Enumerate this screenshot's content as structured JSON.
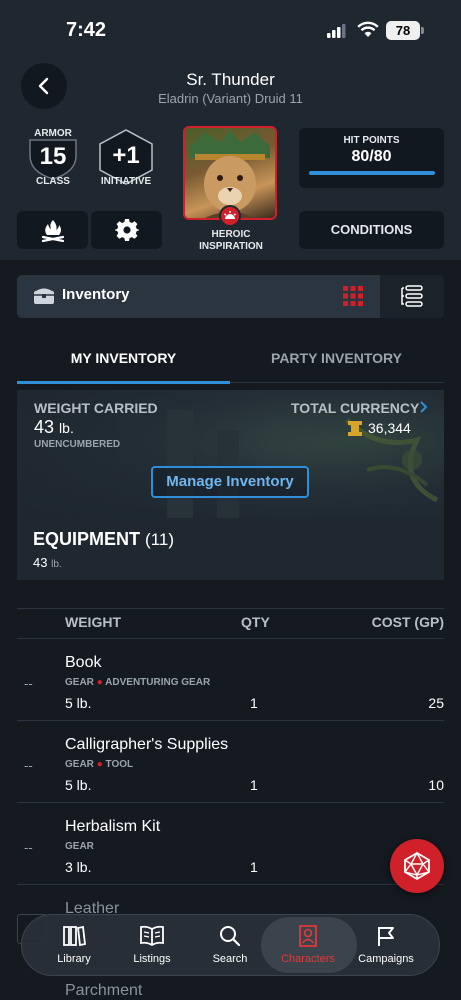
{
  "status_bar": {
    "time": "7:42",
    "battery": "78"
  },
  "header": {
    "name": "Sr. Thunder",
    "subtitle": "Eladrin (Variant) Druid 11",
    "armor": {
      "label_top": "ARMOR",
      "value": "15",
      "label_bottom": "CLASS"
    },
    "initiative": {
      "value": "+1",
      "label": "INITIATIVE"
    },
    "heroic_inspiration": {
      "line1": "HEROIC",
      "line2": "INSPIRATION"
    },
    "hit_points": {
      "label": "HIT POINTS",
      "value": "80/80",
      "fraction": 1.0
    },
    "conditions_label": "CONDITIONS"
  },
  "inventory_bar": {
    "title": "Inventory"
  },
  "tabs": [
    {
      "label": "MY INVENTORY",
      "active": true
    },
    {
      "label": "PARTY INVENTORY",
      "active": false
    }
  ],
  "summary": {
    "weight_label": "WEIGHT CARRIED",
    "weight_value": "43",
    "weight_unit": "lb.",
    "encumbrance": "UNENCUMBERED",
    "currency_label": "TOTAL CURRENCY",
    "currency_value": "36,344",
    "manage_label": "Manage Inventory"
  },
  "equipment": {
    "title": "EQUIPMENT",
    "count": "(11)",
    "weight": "43",
    "weight_unit": "lb."
  },
  "table": {
    "headers": {
      "weight": "WEIGHT",
      "qty": "QTY",
      "cost": "COST (GP)"
    },
    "rows": [
      {
        "dash": "--",
        "name": "Book",
        "tag1": "GEAR",
        "tag2": "ADVENTURING GEAR",
        "weight": "5 lb.",
        "qty": "1",
        "cost": "25"
      },
      {
        "dash": "--",
        "name": "Calligrapher's Supplies",
        "tag1": "GEAR",
        "tag2": "TOOL",
        "weight": "5 lb.",
        "qty": "1",
        "cost": "10"
      },
      {
        "dash": "--",
        "name": "Herbalism Kit",
        "tag1": "GEAR",
        "tag2": "",
        "weight": "3 lb.",
        "qty": "1",
        "cost": ""
      },
      {
        "name": "Leather"
      },
      {
        "name": "Parchment"
      }
    ]
  },
  "nav": [
    {
      "label": "Library",
      "icon": "library-icon"
    },
    {
      "label": "Listings",
      "icon": "book-icon"
    },
    {
      "label": "Search",
      "icon": "search-icon"
    },
    {
      "label": "Characters",
      "icon": "character-icon",
      "active": true
    },
    {
      "label": "Campaigns",
      "icon": "flag-icon"
    }
  ],
  "colors": {
    "accent_blue": "#2f8fd8",
    "brand_red": "#d0212b",
    "background": "#141a20"
  }
}
